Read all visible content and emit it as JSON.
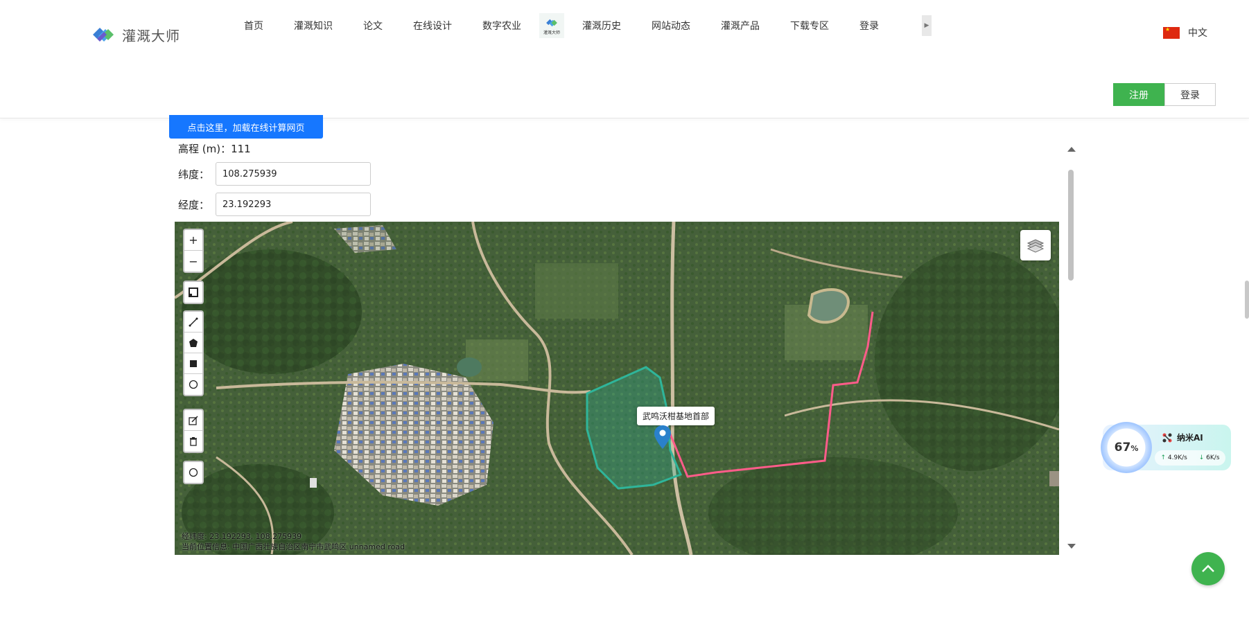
{
  "brand": {
    "name": "灌溉大师"
  },
  "nav": {
    "items": [
      "首页",
      "灌溉知识",
      "论文",
      "在线设计",
      "数字农业"
    ],
    "badge_text": "灌溉大师",
    "items_after": [
      "灌溉历史",
      "网站动态",
      "灌溉产品",
      "下载专区",
      "登录"
    ]
  },
  "language": {
    "label": "中文"
  },
  "auth": {
    "register": "注册",
    "login": "登录"
  },
  "load_button": "点击这里，加载在线计算网页",
  "form": {
    "elevation_label": "高程 (m)：",
    "elevation_value": "111",
    "latitude_label": "纬度：",
    "latitude_value": "108.275939",
    "longitude_label": "经度：",
    "longitude_value": "23.192293"
  },
  "map": {
    "tools": {
      "zoom_in": "+",
      "zoom_out": "−"
    },
    "popup": "武鸣沃柑基地首部",
    "coord_line": "经纬度: 23.192293, 108.275939",
    "address_line": "当前位置信息: 中国广西壮族自治区南宁市武鸣区 unnamed road"
  },
  "ai_widget": {
    "percent": "67",
    "percent_unit": "%",
    "name": "纳米AI",
    "upload": "4.9K/s",
    "download": "6K/s",
    "percent_level": 0.67
  },
  "colors": {
    "accent_green": "#3fb34f",
    "accent_blue": "#1677ff",
    "pipe_line": "#ff5c8a",
    "field_polygon": "#2fb59a"
  }
}
